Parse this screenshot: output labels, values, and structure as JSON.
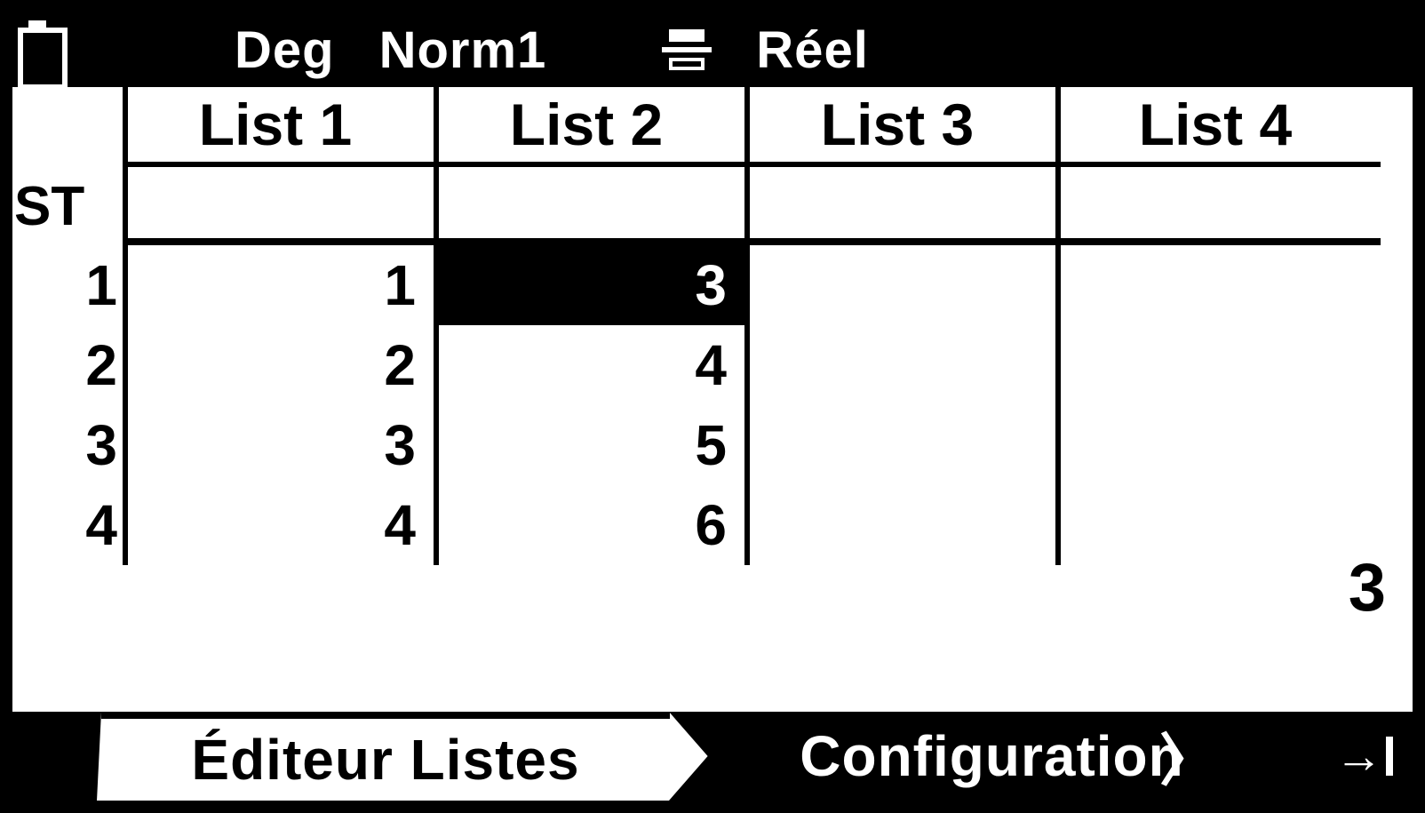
{
  "status": {
    "angle_mode": "Deg",
    "display_mode": "Norm1",
    "number_mode": "Réel"
  },
  "table": {
    "headers": [
      "List 1",
      "List 2",
      "List 3",
      "List 4"
    ],
    "sub_label": "ST",
    "row_indices": [
      "1",
      "2",
      "3",
      "4"
    ],
    "data": {
      "list1": [
        "1",
        "2",
        "3",
        "4"
      ],
      "list2": [
        "3",
        "4",
        "5",
        "6"
      ],
      "list3": [
        "",
        "",
        "",
        ""
      ],
      "list4": [
        "",
        "",
        "",
        ""
      ]
    },
    "selected": {
      "col": 1,
      "row": 0
    }
  },
  "current_value": "3",
  "tabs": {
    "active": "Éditeur Listes",
    "inactive": "Configuration",
    "more_glyph": "→"
  }
}
